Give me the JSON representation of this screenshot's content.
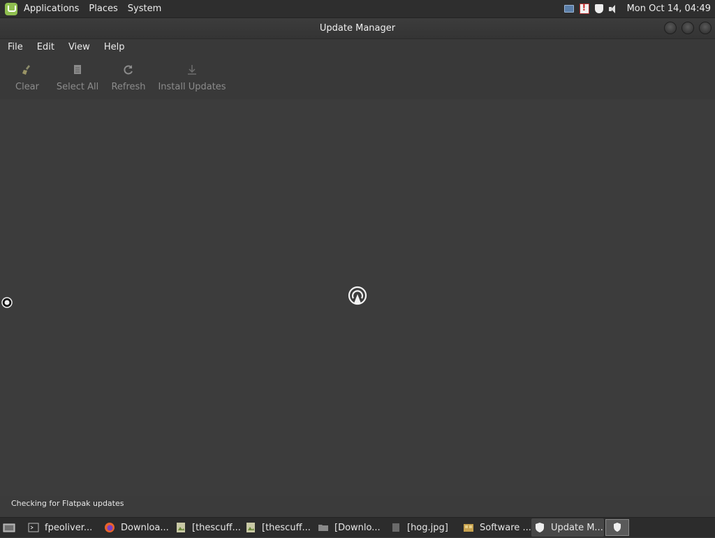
{
  "top_panel": {
    "menus": [
      "Applications",
      "Places",
      "System"
    ],
    "tray_icons": [
      "network-icon",
      "alert-icon",
      "shield-icon",
      "volume-icon"
    ],
    "clock": "Mon Oct 14, 04:49"
  },
  "window": {
    "title": "Update Manager",
    "menu": [
      "File",
      "Edit",
      "View",
      "Help"
    ],
    "toolbar": {
      "clear": "Clear",
      "select_all": "Select All",
      "refresh": "Refresh",
      "install_updates": "Install Updates"
    },
    "status": "Checking for Flatpak updates"
  },
  "taskbar": {
    "tasks": [
      "fpeoliver...",
      "Downloa...",
      "[thescuff...",
      "[thescuff...",
      "[Downlo...",
      "[hog.jpg]",
      "Software ...",
      "Update M..."
    ]
  },
  "colors": {
    "panel_bg": "#2e2e2e",
    "window_bg": "#3c3c3c",
    "accent_mint": "#8fbf4f",
    "disabled_text": "#8c8c8c"
  }
}
